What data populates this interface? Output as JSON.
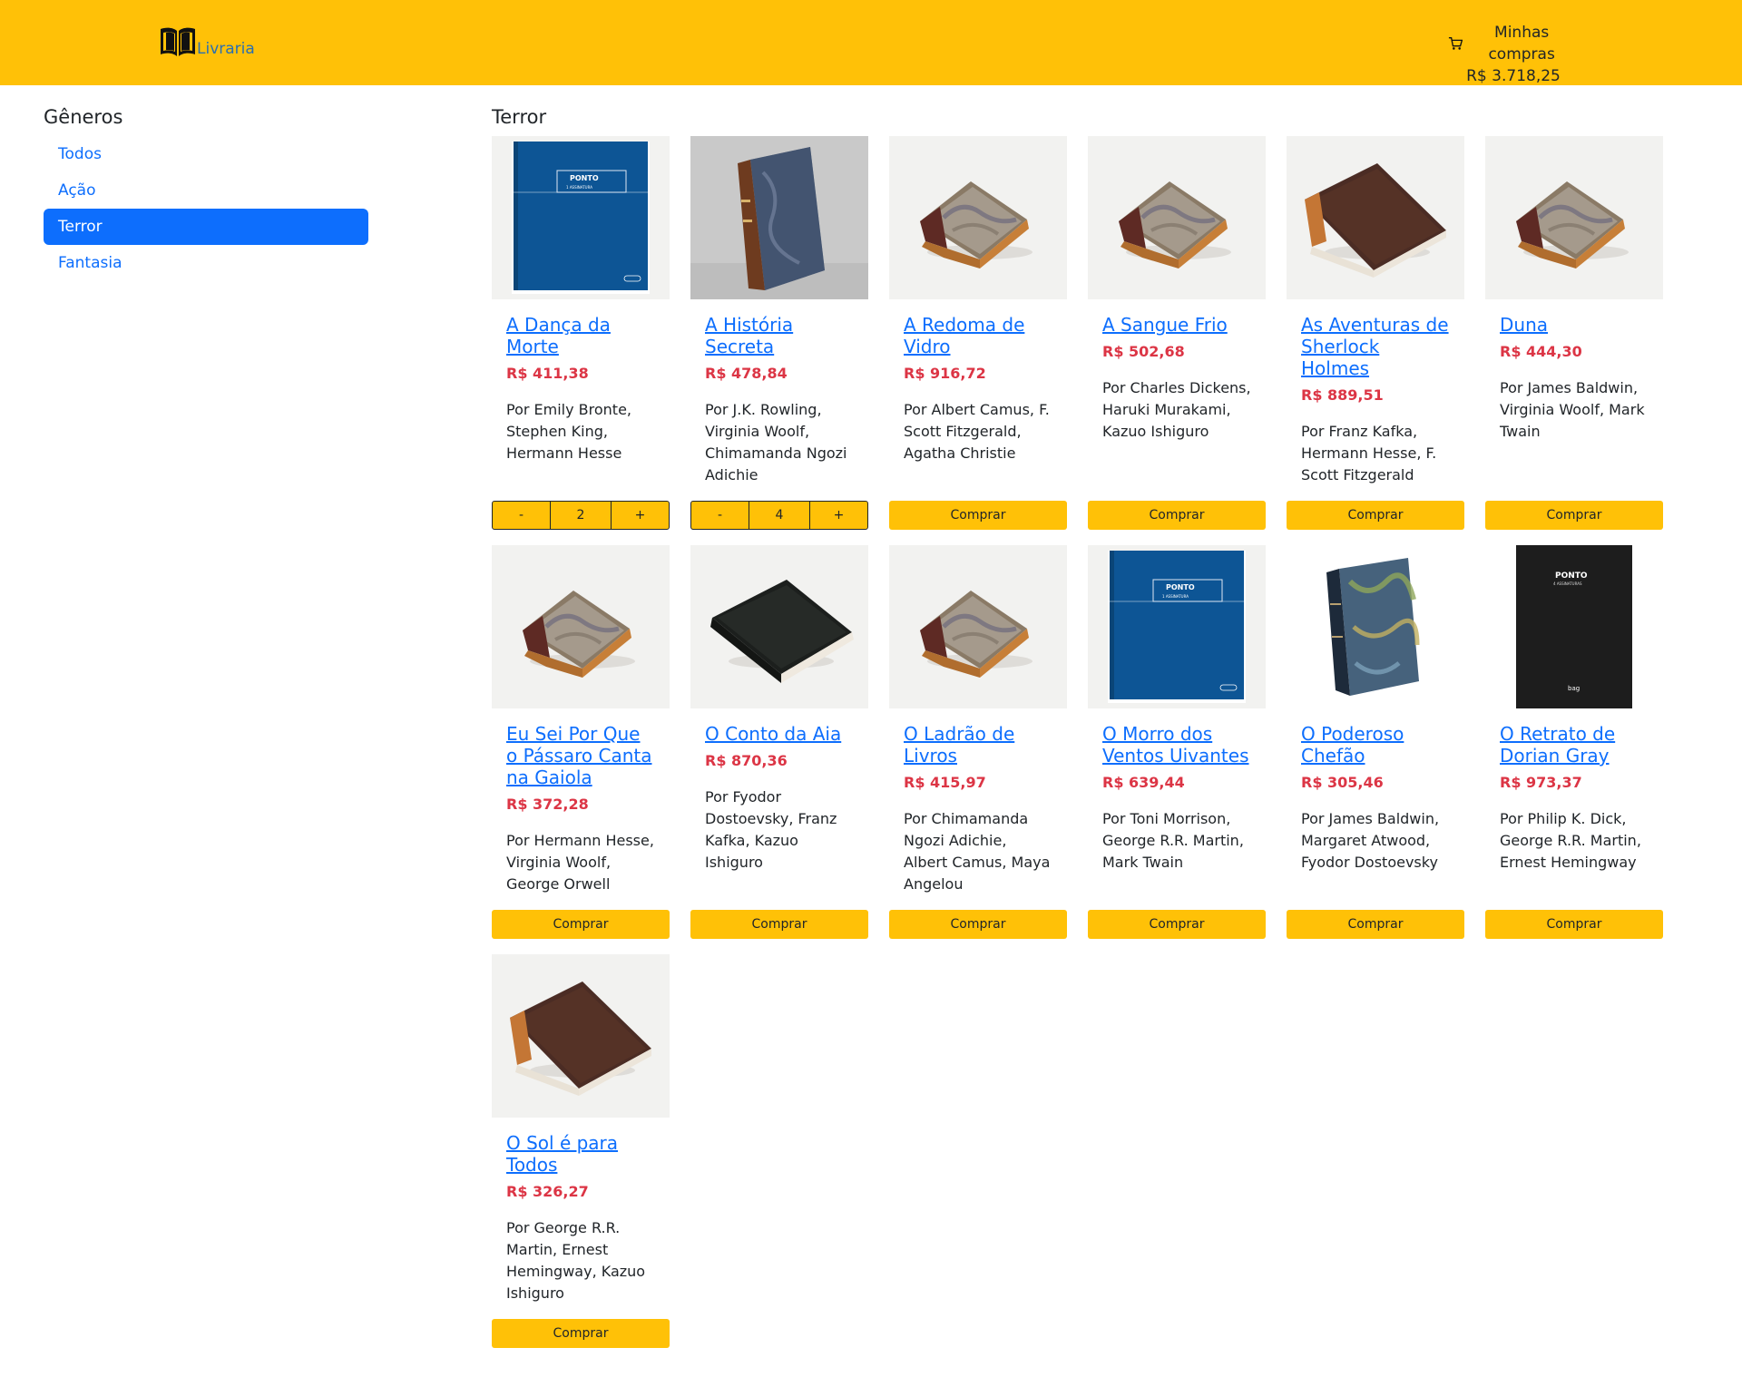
{
  "header": {
    "brand_label": "Livraria",
    "brand_icon": "book-open-icon",
    "cart_label": "Minhas compras",
    "cart_icon": "cart-icon",
    "cart_total": "R$ 3.718,25",
    "bg_color": "#ffc107"
  },
  "sidebar": {
    "heading": "Gêneros",
    "items": [
      {
        "label": "Todos",
        "active": false
      },
      {
        "label": "Ação",
        "active": false
      },
      {
        "label": "Terror",
        "active": true
      },
      {
        "label": "Fantasia",
        "active": false
      }
    ],
    "active_color": "#0d6efd"
  },
  "main": {
    "heading": "Terror",
    "buy_label": "Comprar",
    "minus_label": "-",
    "plus_label": "+",
    "books": [
      {
        "title": "A Dança da Morte",
        "price": "R$ 411,38",
        "authors": "Por Emily Bronte, Stephen King, Hermann Hesse",
        "cover": "blue-notebook",
        "qty": "2"
      },
      {
        "title": "A História Secreta",
        "price": "R$ 478,84",
        "authors": "Por J.K. Rowling, Virginia Woolf, Chimamanda Ngozi Adichie",
        "cover": "marbled-upright",
        "qty": "4"
      },
      {
        "title": "A Redoma de Vidro",
        "price": "R$ 916,72",
        "authors": "Por Albert Camus, F. Scott Fitzgerald, Agatha Christie",
        "cover": "marbled-old"
      },
      {
        "title": "A Sangue Frio",
        "price": "R$ 502,68",
        "authors": "Por Charles Dickens, Haruki Murakami, Kazuo Ishiguro",
        "cover": "marbled-old"
      },
      {
        "title": "As Aventuras de Sherlock Holmes",
        "price": "R$ 889,51",
        "authors": "Por Franz Kafka, Hermann Hesse, F. Scott Fitzgerald",
        "cover": "brown-leather"
      },
      {
        "title": "Duna",
        "price": "R$ 444,30",
        "authors": "Por James Baldwin, Virginia Woolf, Mark Twain",
        "cover": "marbled-old"
      },
      {
        "title": "Eu Sei Por Que o Pássaro Canta na Gaiola",
        "price": "R$ 372,28",
        "authors": "Por Hermann Hesse, Virginia Woolf, George Orwell",
        "cover": "marbled-old"
      },
      {
        "title": "O Conto da Aia",
        "price": "R$ 870,36",
        "authors": "Por Fyodor Dostoevsky, Franz Kafka, Kazuo Ishiguro",
        "cover": "black-book"
      },
      {
        "title": "O Ladrão de Livros",
        "price": "R$ 415,97",
        "authors": "Por Chimamanda Ngozi Adichie, Albert Camus, Maya Angelou",
        "cover": "marbled-old"
      },
      {
        "title": "O Morro dos Ventos Uivantes",
        "price": "R$ 639,44",
        "authors": "Por Toni Morrison, George R.R. Martin, Mark Twain",
        "cover": "blue-notebook"
      },
      {
        "title": "O Poderoso Chefão",
        "price": "R$ 305,46",
        "authors": "Por James Baldwin, Margaret Atwood, Fyodor Dostoevsky",
        "cover": "marbled-blue-upright"
      },
      {
        "title": "O Retrato de Dorian Gray",
        "price": "R$ 973,37",
        "authors": "Por Philip K. Dick, George R.R. Martin, Ernest Hemingway",
        "cover": "black-notebook"
      },
      {
        "title": "O Sol é para Todos",
        "price": "R$ 326,27",
        "authors": "Por George R.R. Martin, Ernest Hemingway, Kazuo Ishiguro",
        "cover": "brown-leather"
      }
    ],
    "cover_texts": {
      "notebook_title": "PONTO",
      "notebook_sub": "1 ASSINATURA",
      "black_sub": "4 ASSINATURAS",
      "black_brand": "bag"
    }
  }
}
